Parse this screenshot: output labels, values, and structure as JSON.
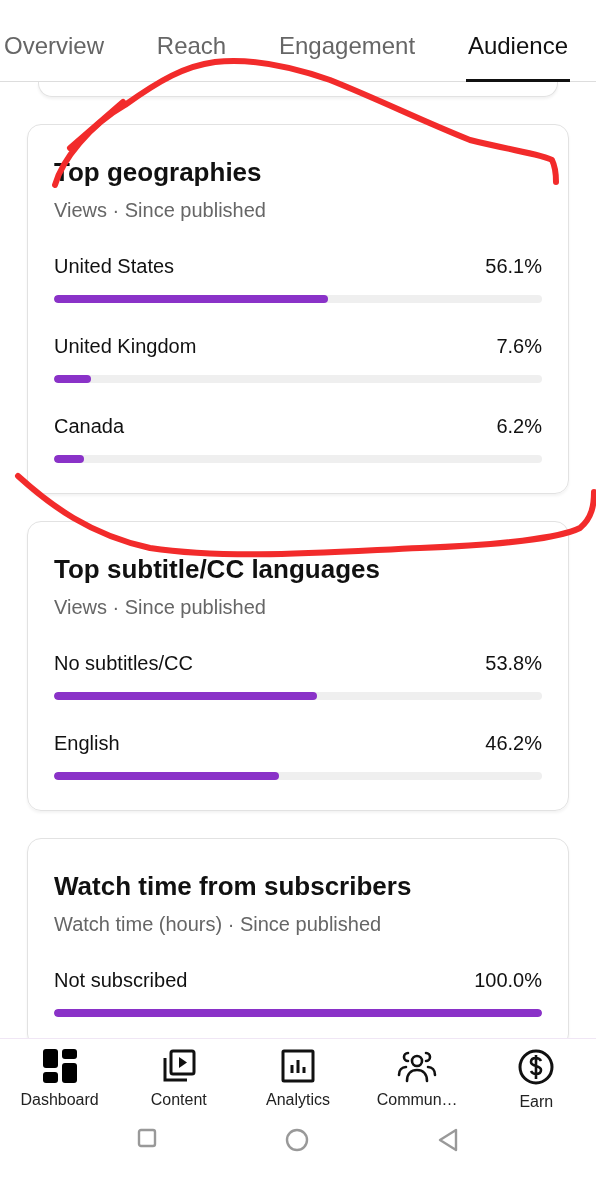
{
  "tabs": [
    {
      "label": "Overview",
      "selected": false
    },
    {
      "label": "Reach",
      "selected": false
    },
    {
      "label": "Engagement",
      "selected": false
    },
    {
      "label": "Audience",
      "selected": true
    }
  ],
  "cards": [
    {
      "title": "Top geographies",
      "subtitle": "Views · Since published",
      "rows": [
        {
          "label": "United States",
          "value": "56.1%",
          "level": 0.561
        },
        {
          "label": "United Kingdom",
          "value": "7.6%",
          "level": 0.076
        },
        {
          "label": "Canada",
          "value": "6.2%",
          "level": 0.062
        }
      ]
    },
    {
      "title": "Top subtitle/CC languages",
      "subtitle": "Views · Since published",
      "rows": [
        {
          "label": "No subtitles/CC",
          "value": "53.8%",
          "level": 0.538
        },
        {
          "label": "English",
          "value": "46.2%",
          "level": 0.462
        }
      ]
    },
    {
      "title": "Watch time from subscribers",
      "subtitle": "Watch time (hours) · Since published",
      "rows": [
        {
          "label": "Not subscribed",
          "value": "100.0%",
          "level": 1.0
        }
      ]
    }
  ],
  "nav": [
    {
      "label": "Dashboard",
      "kind": "dashboard"
    },
    {
      "label": "Content",
      "kind": "content"
    },
    {
      "label": "Analytics",
      "kind": "analytics"
    },
    {
      "label": "Commun…",
      "kind": "community"
    },
    {
      "label": "Earn",
      "kind": "earn"
    }
  ],
  "annotations": [
    {
      "kind": "freehand-loop"
    }
  ]
}
